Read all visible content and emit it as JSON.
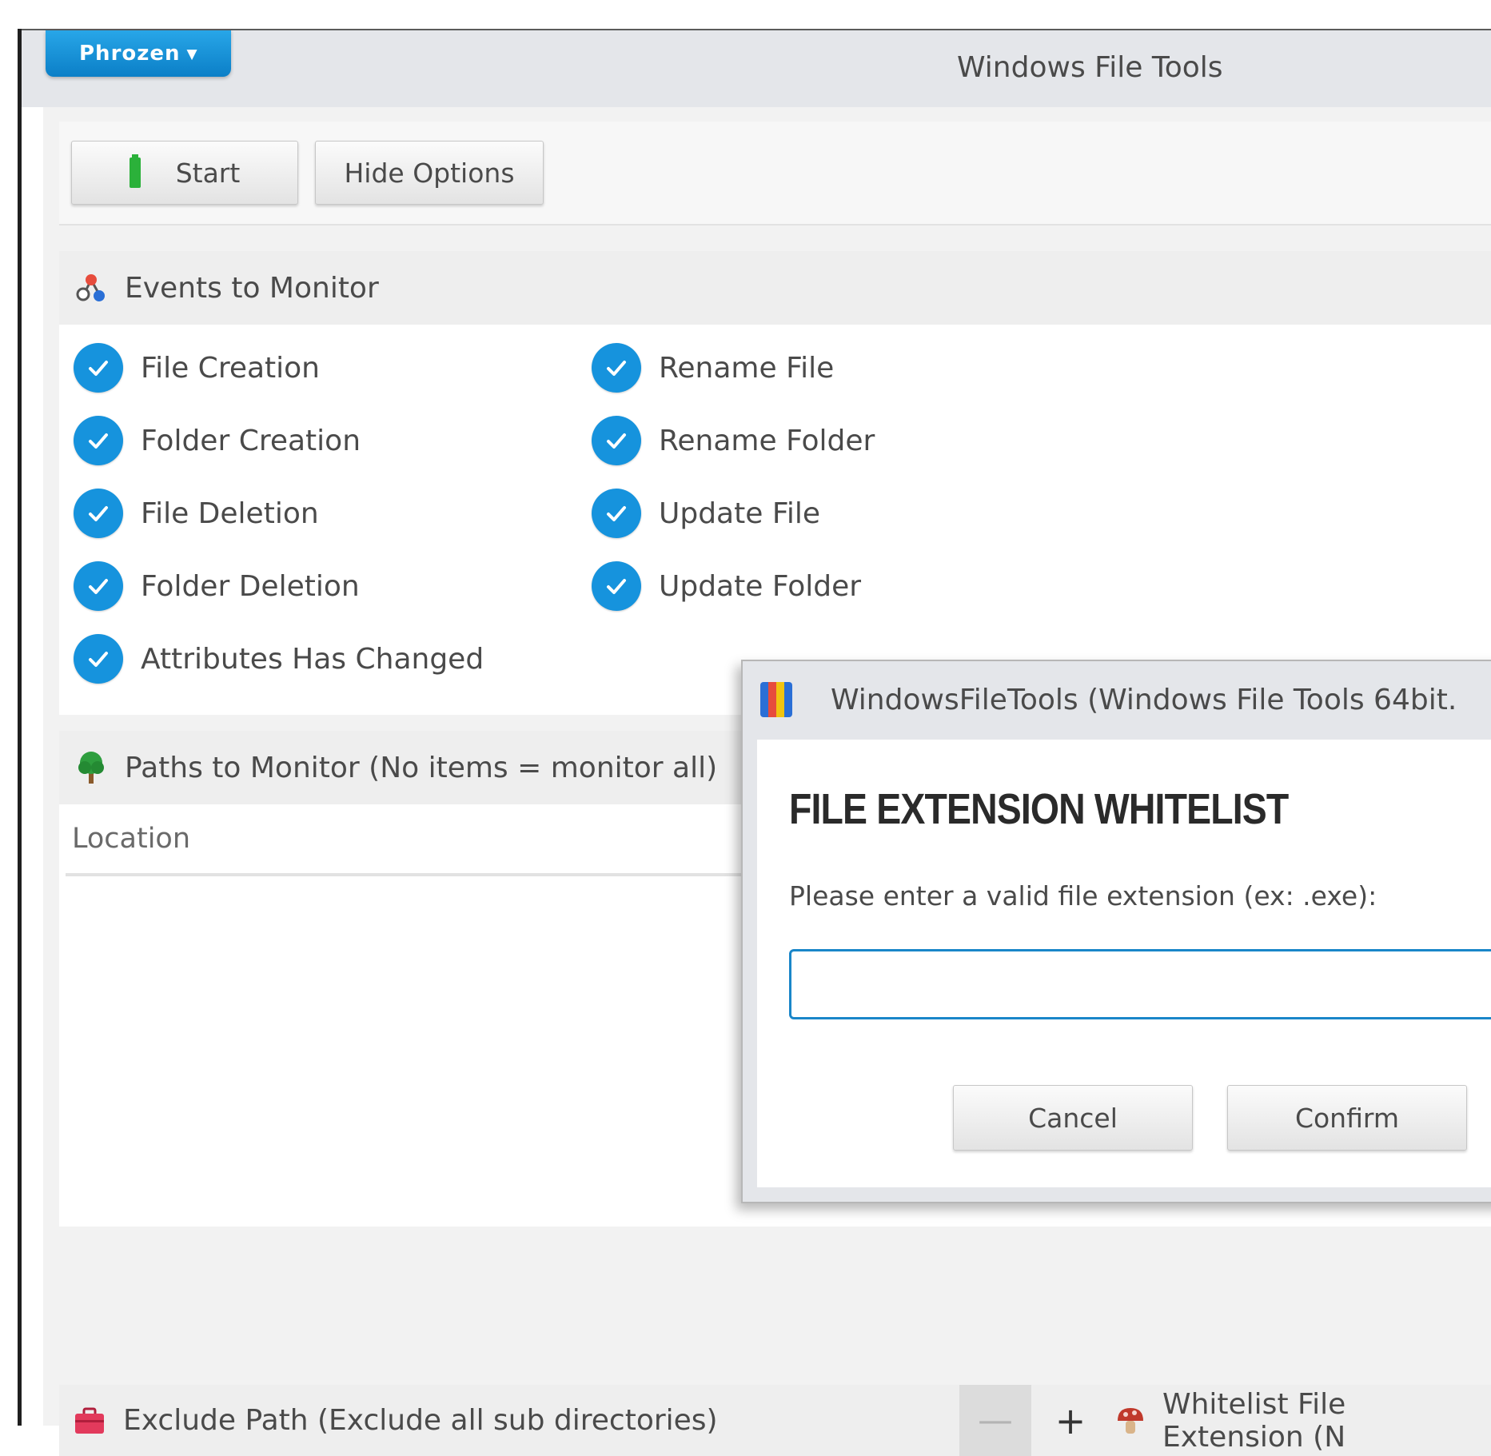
{
  "window": {
    "brand_label": "Phrozen",
    "title": "Windows File Tools"
  },
  "toolbar": {
    "start_label": "Start",
    "hide_options_label": "Hide Options"
  },
  "events": {
    "header": "Events to Monitor",
    "items": [
      {
        "label": "File Creation",
        "checked": true
      },
      {
        "label": "Folder Creation",
        "checked": true
      },
      {
        "label": "File Deletion",
        "checked": true
      },
      {
        "label": "Folder Deletion",
        "checked": true
      },
      {
        "label": "Attributes Has Changed",
        "checked": true
      },
      {
        "label": "Rename File",
        "checked": true
      },
      {
        "label": "Rename Folder",
        "checked": true
      },
      {
        "label": "Update File",
        "checked": true
      },
      {
        "label": "Update Folder",
        "checked": true
      }
    ]
  },
  "paths": {
    "header": "Paths to Monitor (No items = monitor all)",
    "column_location": "Location"
  },
  "bottom": {
    "exclude_label": "Exclude Path (Exclude all sub directories)",
    "minus_label": "—",
    "plus_label": "+",
    "whitelist_label": "Whitelist File Extension (N"
  },
  "dialog": {
    "title": "WindowsFileTools (Windows File Tools 64bit.",
    "heading": "FILE EXTENSION WHITELIST",
    "prompt": "Please enter a valid file extension (ex: .exe):",
    "input_value": "",
    "cancel_label": "Cancel",
    "confirm_label": "Confirm"
  },
  "colors": {
    "accent": "#1693dd",
    "brand": "#0b7fc7",
    "start_battery": "#2bb13a"
  },
  "icons": {
    "events": "network-nodes-icon",
    "paths": "tree-icon",
    "exclude": "briefcase-icon",
    "whitelist": "mushroom-icon",
    "dialog": "app-icon"
  }
}
